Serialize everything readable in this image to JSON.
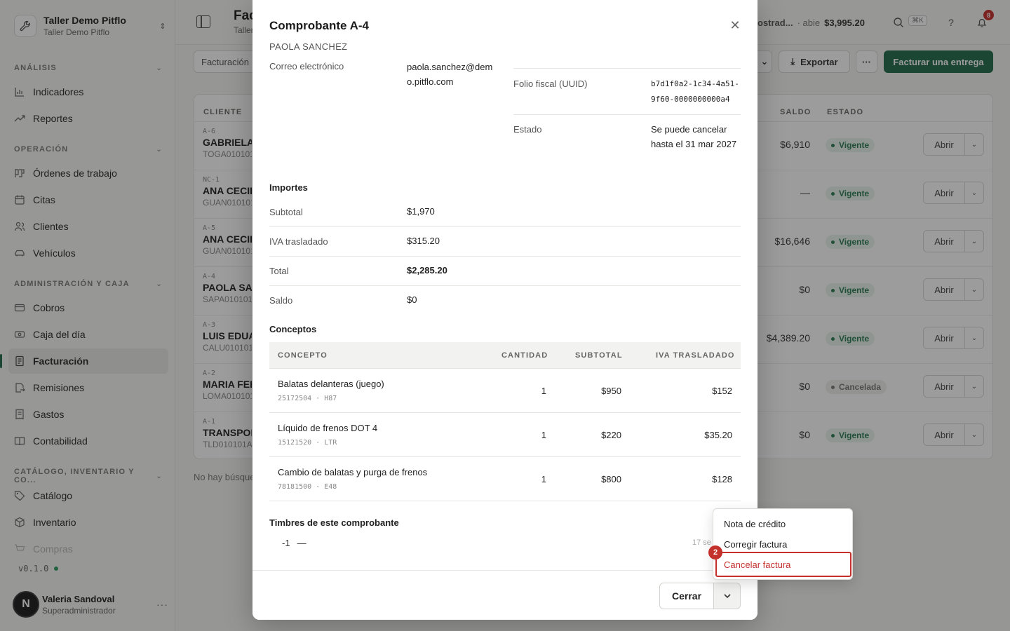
{
  "org": {
    "name": "Taller Demo Pitflo",
    "subtitle": "Taller Demo Pitflo"
  },
  "sidebar": {
    "sections": [
      {
        "title": "ANÁLISIS"
      },
      {
        "title": "OPERACIÓN"
      },
      {
        "title": "ADMINISTRACIÓN Y CAJA"
      },
      {
        "title": "CATÁLOGO, INVENTARIO Y CO..."
      }
    ],
    "items": [
      {
        "label": "Indicadores"
      },
      {
        "label": "Reportes"
      },
      {
        "label": "Órdenes de trabajo"
      },
      {
        "label": "Citas"
      },
      {
        "label": "Clientes"
      },
      {
        "label": "Vehículos"
      },
      {
        "label": "Cobros"
      },
      {
        "label": "Caja del día"
      },
      {
        "label": "Facturación"
      },
      {
        "label": "Remisiones"
      },
      {
        "label": "Gastos"
      },
      {
        "label": "Contabilidad"
      },
      {
        "label": "Catálogo"
      },
      {
        "label": "Inventario"
      },
      {
        "label": "Compras"
      }
    ],
    "active_item": "Facturación",
    "version": "v0.1.0",
    "user": {
      "initial": "N",
      "name": "Valeria Sandoval",
      "role": "Superadministrador"
    }
  },
  "header": {
    "title": "Fac",
    "subtitle": "Taller",
    "status_trunc": "ostrad...",
    "status_sep": "· abie",
    "amount": "$3,995.20",
    "shortcut": "⌘K",
    "help": "?",
    "notif_count": "8"
  },
  "toolbar": {
    "filter_label": "Facturación",
    "export_label": "Exportar",
    "more_label": "···",
    "primary_label": "Facturar una entrega"
  },
  "table": {
    "headers": {
      "cliente": "CLIENTE",
      "saldo": "SALDO",
      "estado": "ESTADO"
    },
    "rows": [
      {
        "folio": "A-6",
        "name": "GABRIELA",
        "rfc": "TOGA010101",
        "saldo": "$6,910",
        "estado": "Vigente"
      },
      {
        "folio": "NC-1",
        "name": "ANA CECIL",
        "rfc": "GUAN010101",
        "saldo": "—",
        "estado": "Vigente"
      },
      {
        "folio": "A-5",
        "name": "ANA CECIL",
        "rfc": "GUAN010101",
        "saldo": "$16,646",
        "estado": "Vigente"
      },
      {
        "folio": "A-4",
        "name": "PAOLA SAN",
        "rfc": "SAPA010101",
        "saldo": "$0",
        "estado": "Vigente"
      },
      {
        "folio": "A-3",
        "name": "LUIS EDUA",
        "rfc": "CALU010101",
        "saldo": "$4,389.20",
        "estado": "Vigente"
      },
      {
        "folio": "A-2",
        "name": "MARIA FER",
        "rfc": "LOMA010101",
        "saldo": "$0",
        "estado": "Cancelada"
      },
      {
        "folio": "A-1",
        "name": "TRANSPOR",
        "rfc": "TLD010101A",
        "saldo": "$0",
        "estado": "Vigente"
      }
    ],
    "open_label": "Abrir",
    "empty_note": "No hay búsque"
  },
  "modal": {
    "title": "Comprobante A-4",
    "subtitle": "PAOLA SANCHEZ",
    "email_label": "Correo electrónico",
    "email_value": "paola.sanchez@demo.pitflo.com",
    "uuid_label": "Folio fiscal (UUID)",
    "uuid_value": "b7d1f0a2-1c34-4a51-9f60-0000000000a4",
    "estado_label": "Estado",
    "estado_value": "Se puede cancelar hasta el 31 mar 2027",
    "importes_title": "Importes",
    "importes": [
      {
        "label": "Subtotal",
        "value": "$1,970"
      },
      {
        "label": "IVA trasladado",
        "value": "$315.20"
      },
      {
        "label": "Total",
        "value": "$2,285.20"
      },
      {
        "label": "Saldo",
        "value": "$0"
      }
    ],
    "conceptos_title": "Conceptos",
    "conceptos_headers": {
      "concepto": "CONCEPTO",
      "cantidad": "CANTIDAD",
      "subtotal": "SUBTOTAL",
      "iva": "IVA TRASLADADO"
    },
    "conceptos": [
      {
        "name": "Balatas delanteras (juego)",
        "code": "25172504 · H87",
        "cantidad": "1",
        "subtotal": "$950",
        "iva": "$152"
      },
      {
        "name": "Líquido de frenos DOT 4",
        "code": "15121520 · LTR",
        "cantidad": "1",
        "subtotal": "$220",
        "iva": "$35.20"
      },
      {
        "name": "Cambio de balatas y purga de frenos",
        "code": "78181500 · E48",
        "cantidad": "1",
        "subtotal": "$800",
        "iva": "$128"
      }
    ],
    "timbres_title": "Timbres de este comprobante",
    "timbre_num": "-1",
    "timbre_dash": "—",
    "timbre_right": "17 se",
    "close_label": "Cerrar"
  },
  "menu": {
    "items": [
      {
        "label": "Nota de crédito"
      },
      {
        "label": "Corregir factura"
      },
      {
        "label": "Cancelar factura"
      }
    ],
    "step": "2"
  },
  "colors": {
    "accent": "#1f6b4a",
    "danger": "#c4302b",
    "success": "#2b7a51"
  }
}
